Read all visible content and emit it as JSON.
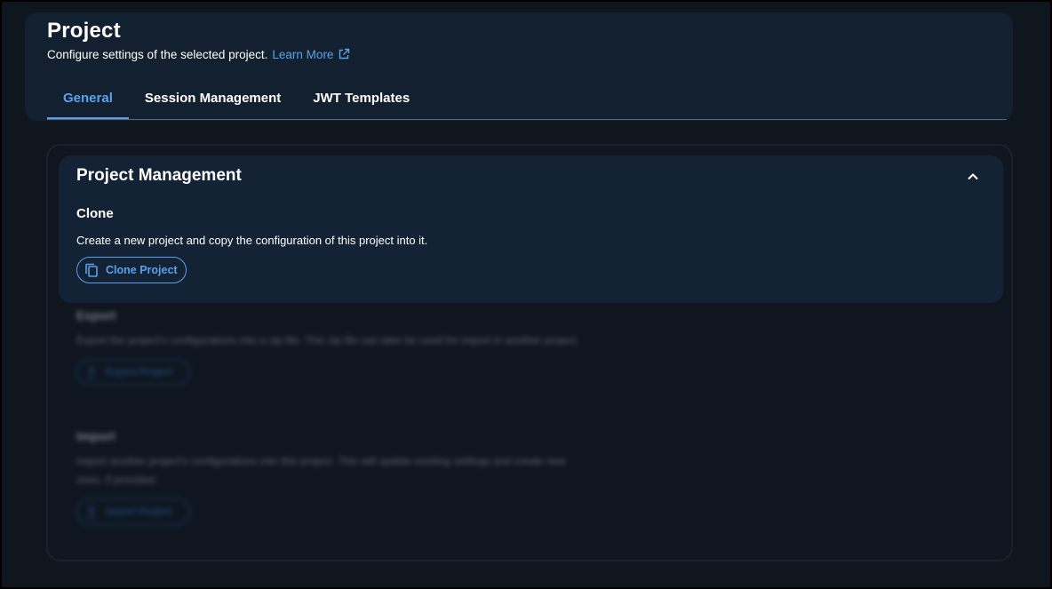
{
  "header": {
    "title": "Project",
    "subtitle": "Configure settings of the selected project.",
    "learn_more": "Learn More"
  },
  "tabs": [
    {
      "label": "General",
      "active": true
    },
    {
      "label": "Session Management",
      "active": false
    },
    {
      "label": "JWT Templates",
      "active": false
    }
  ],
  "management": {
    "title": "Project Management",
    "clone": {
      "heading": "Clone",
      "description": "Create a new project and copy the configuration of this project into it.",
      "button": "Clone Project"
    },
    "export": {
      "heading": "Export",
      "description": "Export the project's configurations into a zip file. This zip file can later be used for import in another project.",
      "button": "Export Project"
    },
    "import": {
      "heading": "Import",
      "description": "Import another project's configurations into this project. This will update existing settings and create new ones, if provided.",
      "button": "Import Project"
    }
  },
  "colors": {
    "accent": "#5aa2ec",
    "background": "#10161e",
    "card": "#142235"
  },
  "icons": [
    "external-link-icon",
    "chevron-up-icon",
    "copy-icon",
    "upload-icon"
  ]
}
